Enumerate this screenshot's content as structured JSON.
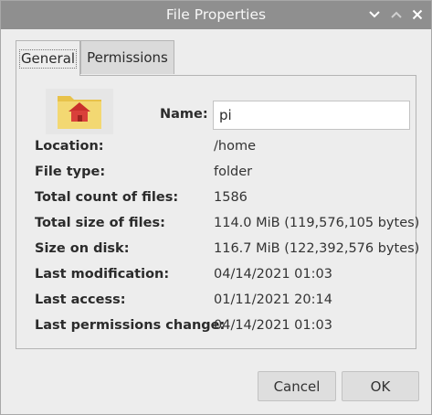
{
  "window": {
    "title": "File Properties",
    "controls": {
      "minimize": "chevron-down-icon",
      "maximize": "chevron-up-icon",
      "close": "close-icon"
    }
  },
  "tabs": [
    {
      "label": "General",
      "active": true
    },
    {
      "label": "Permissions",
      "active": false
    }
  ],
  "general": {
    "icon": "home-folder-icon",
    "name_label": "Name:",
    "name_value": "pi",
    "rows": [
      {
        "label": "Location:",
        "value": "/home"
      },
      {
        "label": "File type:",
        "value": "folder"
      },
      {
        "label": "Total count of files:",
        "value": "1586"
      },
      {
        "label": "Total size of files:",
        "value": "114.0 MiB (119,576,105 bytes)"
      },
      {
        "label": "Size on disk:",
        "value": "116.7 MiB (122,392,576 bytes)"
      },
      {
        "label": "Last modification:",
        "value": "04/14/2021 01:03"
      },
      {
        "label": "Last access:",
        "value": "01/11/2021 20:14"
      },
      {
        "label": "Last permissions change:",
        "value": "04/14/2021 01:03"
      }
    ]
  },
  "buttons": {
    "cancel": "Cancel",
    "ok": "OK"
  },
  "colors": {
    "titlebar": "#8f8f8f",
    "folder": "#f0d56a",
    "house": "#d9403a",
    "background": "#ededed"
  }
}
